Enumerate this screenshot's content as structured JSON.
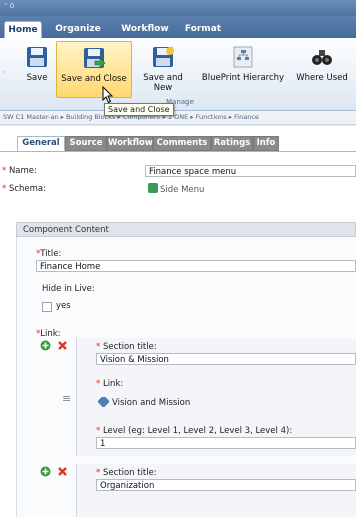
{
  "window": {
    "title": "⁼ 0"
  },
  "ribbon_tabs": [
    "Home",
    "Organize",
    "Workflow",
    "Format"
  ],
  "ribbon_buttons": {
    "save": "Save",
    "save_and_close": "Save and Close",
    "save_and_new": "Save and New",
    "blueprint": "BluePrint Hierarchy",
    "where_used": "Where Used"
  },
  "ribbon_group_label": "Manage",
  "tooltip": "Save and Close",
  "breadcrumb": "SW C1 Master-an ▸ Building Blocks ▸ Component ▸ 1 ONE ▸ Functions ▸ Finance",
  "form_tabs": [
    "General",
    "Source",
    "Workflow",
    "Comments",
    "Ratings",
    "Info"
  ],
  "fields": {
    "name_label": "Name:",
    "name_value": "Finance space menu",
    "schema_label": "Schema:",
    "schema_value": "Side Menu"
  },
  "section": {
    "title": "Component Content",
    "title_label": "Title:",
    "title_value": "Finance Home",
    "hide_label": "Hide in Live:",
    "hide_option": "yes",
    "link_label": "Link:"
  },
  "links": [
    {
      "section_title_label": "Section title:",
      "section_title_value": "Vision & Mission",
      "link_label": "Link:",
      "link_value": "Vision and Mission",
      "level_label": "Level (eg: Level 1, Level 2, Level 3, Level 4):",
      "level_value": "1"
    },
    {
      "section_title_label": "Section title:",
      "section_title_value": "Organization"
    }
  ],
  "colors": {
    "ribbon_active": "#ffd870",
    "required_star": "#d62a1e",
    "add_green": "#3a9a3a",
    "remove_red": "#d23a2a"
  }
}
